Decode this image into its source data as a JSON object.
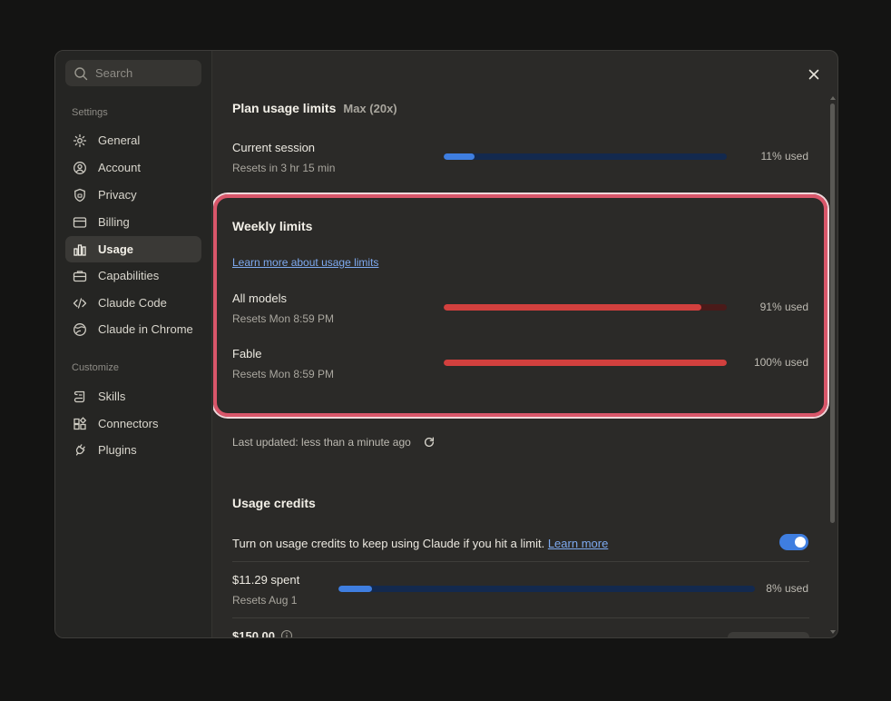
{
  "sidebar": {
    "search_placeholder": "Search",
    "settings_heading": "Settings",
    "items": [
      {
        "label": "General",
        "icon": "gear-icon"
      },
      {
        "label": "Account",
        "icon": "user-icon"
      },
      {
        "label": "Privacy",
        "icon": "shield-icon"
      },
      {
        "label": "Billing",
        "icon": "card-icon"
      },
      {
        "label": "Usage",
        "icon": "chart-icon"
      },
      {
        "label": "Capabilities",
        "icon": "briefcase-icon"
      },
      {
        "label": "Claude Code",
        "icon": "code-icon"
      },
      {
        "label": "Claude in Chrome",
        "icon": "globe-icon"
      }
    ],
    "customize_heading": "Customize",
    "customize_items": [
      {
        "label": "Skills",
        "icon": "scroll-icon"
      },
      {
        "label": "Connectors",
        "icon": "grid-icon"
      },
      {
        "label": "Plugins",
        "icon": "plug-icon"
      }
    ]
  },
  "plan": {
    "title": "Plan usage limits",
    "badge": "Max (20x)",
    "session_label": "Current session",
    "session_reset": "Resets in 3 hr 15 min",
    "session_pct_text": "11% used",
    "session_fraction": 0.11
  },
  "weekly": {
    "title": "Weekly limits",
    "learn_more": "Learn more about usage limits",
    "rows": [
      {
        "label": "All models",
        "reset": "Resets Mon 8:59 PM",
        "pct_text": "91% used",
        "fraction": 0.91
      },
      {
        "label": "Fable",
        "reset": "Resets Mon 8:59 PM",
        "pct_text": "100% used",
        "fraction": 1.0
      }
    ]
  },
  "last_updated": "Last updated: less than a minute ago",
  "credits": {
    "title": "Usage credits",
    "description": "Turn on usage credits to keep using Claude if you hit a limit.",
    "learn_more": "Learn more",
    "toggle_on": true,
    "spent_label": "$11.29 spent",
    "spent_reset": "Resets Aug 1",
    "spent_pct_text": "8% used",
    "spent_fraction": 0.08,
    "limit_label": "$150.00"
  },
  "colors": {
    "accent_blue": "#3f7ee0",
    "track_blue": "#13294e",
    "limit_red": "#d2403e",
    "track_red": "#4a1a19",
    "highlight": "#d9566a"
  }
}
